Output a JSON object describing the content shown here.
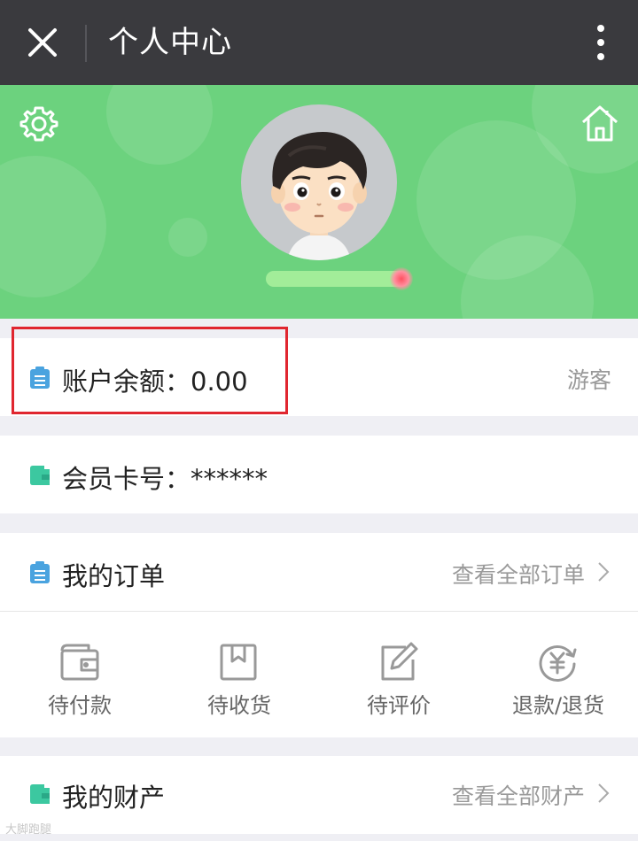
{
  "header": {
    "title": "个人中心",
    "close_icon": "close-icon",
    "more_icon": "more-vertical-icon"
  },
  "hero": {
    "settings_icon": "gear-icon",
    "home_icon": "home-icon",
    "avatar": "cartoon-boy-avatar"
  },
  "account": {
    "label": "账户余额：0.00",
    "status": "游客",
    "icon": "clipboard-icon",
    "icon_color": "#4aa3df"
  },
  "member": {
    "label": "会员卡号：******",
    "icon": "wallet-icon",
    "icon_color": "#3cc8a0"
  },
  "orders": {
    "title": "我的订单",
    "view_all": "查看全部订单",
    "items": [
      {
        "label": "待付款",
        "icon": "wallet-icon"
      },
      {
        "label": "待收货",
        "icon": "package-icon"
      },
      {
        "label": "待评价",
        "icon": "edit-icon"
      },
      {
        "label": "退款/退货",
        "icon": "refund-yen-icon"
      }
    ]
  },
  "assets": {
    "title": "我的财产",
    "view_all": "查看全部财产"
  },
  "colors": {
    "topbar": "#3a3a3e",
    "hero": "#6cd27e",
    "highlight": "#e0262f"
  },
  "watermark": "大脚跑腿"
}
